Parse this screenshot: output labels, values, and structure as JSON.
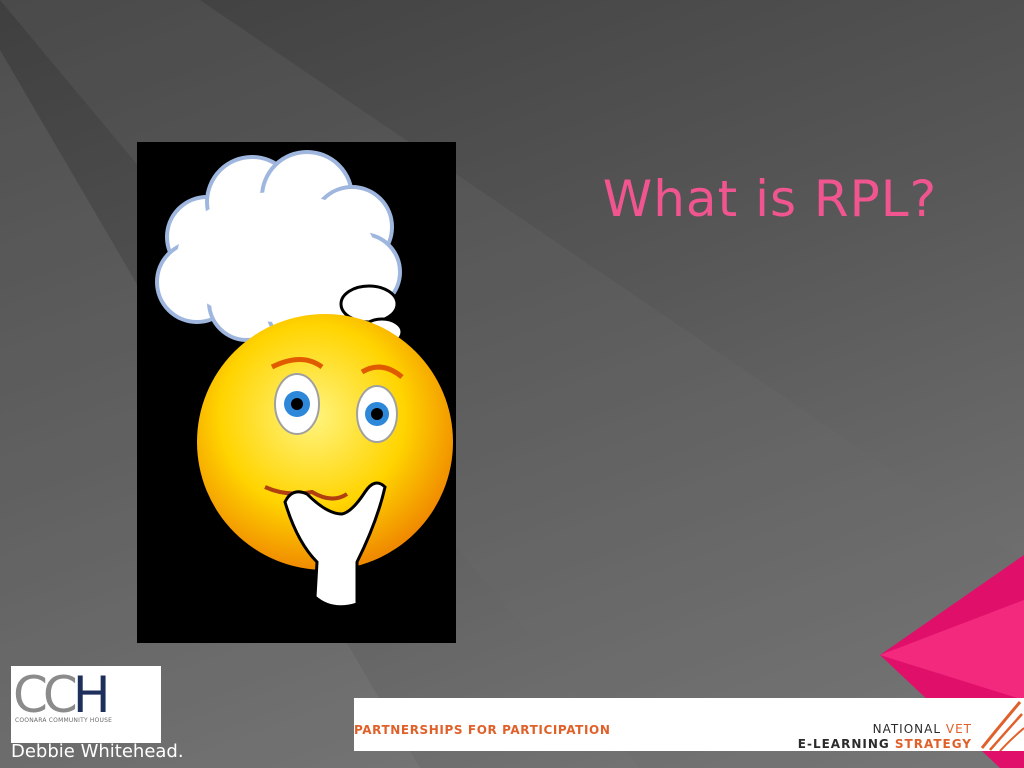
{
  "slide": {
    "title": "What is RPL?",
    "author": "Debbie Whitehead.",
    "illustration_icon": "thinking-smiley-icon"
  },
  "logo_cch": {
    "letters_grey": "CC",
    "letters_dark": "H",
    "subtitle": "COONARA COMMUNITY HOUSE"
  },
  "footer": {
    "partnerships": "PARTNERSHIPS FOR PARTICIPATION",
    "national": "NATIONAL",
    "vet": "VET",
    "elearning": "E-LEARNING",
    "strategy": "STRATEGY"
  },
  "colors": {
    "title": "#f0558f",
    "accent_pink": "#e0106a",
    "footer_orange": "#e0602a"
  }
}
